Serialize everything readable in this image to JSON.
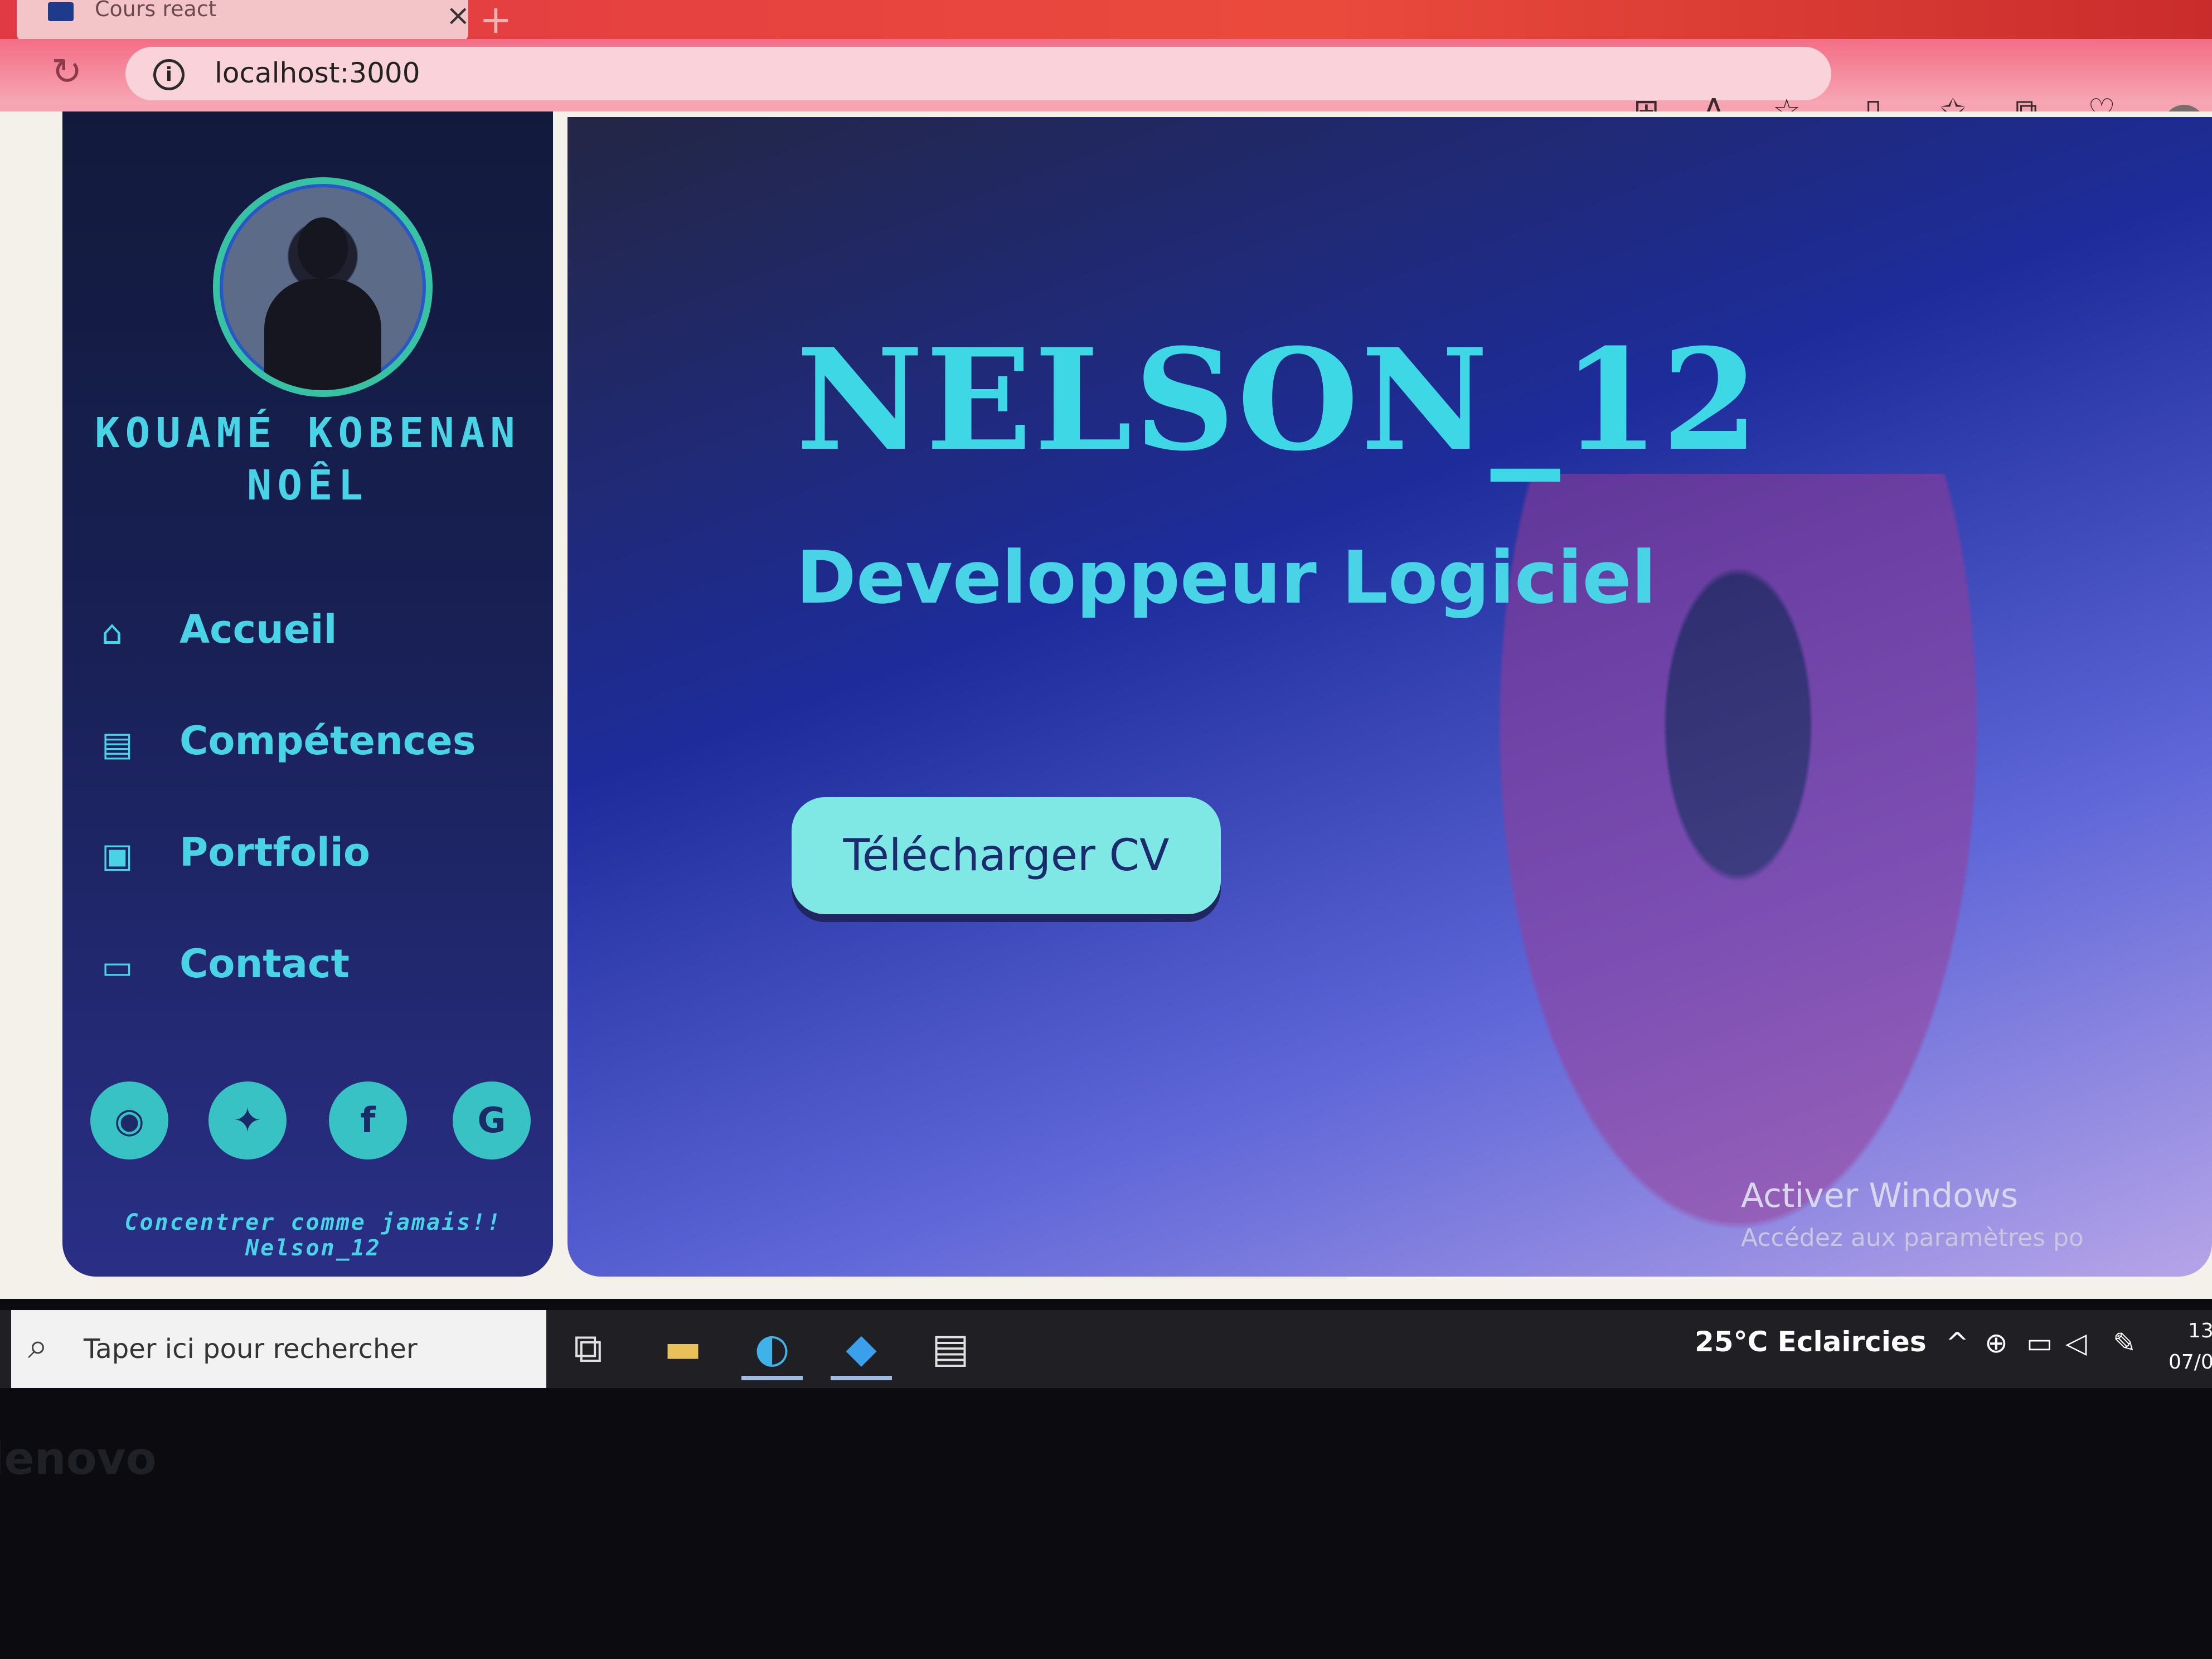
{
  "browser": {
    "tab_title": "Cours react",
    "tab_close": "×",
    "new_tab": "+",
    "url": "localhost:3000",
    "icons": [
      "apps-icon",
      "read-aloud-icon",
      "favorite-star-icon",
      "split-screen-icon",
      "favorites-icon",
      "collections-icon",
      "browser-essentials-icon",
      "profile-icon"
    ]
  },
  "sidebar": {
    "full_name": "KOUAMÉ KOBENAN NOÊL",
    "nav": [
      {
        "label": "Accueil",
        "icon": "home-icon"
      },
      {
        "label": "Compétences",
        "icon": "book-icon"
      },
      {
        "label": "Portfolio",
        "icon": "briefcase-icon"
      },
      {
        "label": "Contact",
        "icon": "contact-card-icon"
      }
    ],
    "social": [
      "github-icon",
      "twitter-icon",
      "facebook-icon",
      "google-icon"
    ],
    "tagline": "Concentrer comme jamais!! Nelson_12"
  },
  "hero": {
    "name": "NELSON_12",
    "role": "Developpeur Logiciel",
    "cv_button": "Télécharger CV"
  },
  "watermark": {
    "title": "Activer Windows",
    "subtitle": "Accédez aux paramètres po"
  },
  "taskbar": {
    "search_placeholder": "Taper ici pour rechercher",
    "weather": "25°C  Eclaircies",
    "time": "13",
    "date": "07/0"
  },
  "colors": {
    "accent_cyan": "#49d3e6",
    "sidebar_bg": "#182055",
    "button_bg": "#7fe8e4",
    "browser_red": "#e23a44"
  }
}
